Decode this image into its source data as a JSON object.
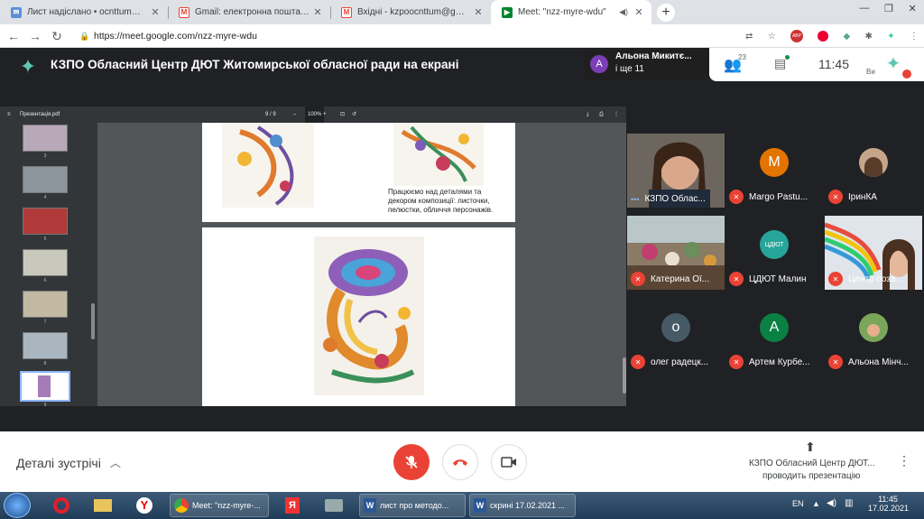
{
  "browser": {
    "tabs": [
      {
        "title": "Лист надіслано • ocnttum@ukr.",
        "icon": "mail-icon",
        "color": "#5b8fd6"
      },
      {
        "title": "Gmail: електронна пошта від Go",
        "icon": "gmail-icon",
        "color": "#ea4335"
      },
      {
        "title": "Вхідні - kzpoocnttum@gmail.com",
        "icon": "gmail-icon",
        "color": "#ea4335"
      },
      {
        "title": "Meet: \"nzz-myre-wdu\"",
        "icon": "meet-icon",
        "color": "#00832d"
      }
    ],
    "url": "https://meet.google.com/nzz-myre-wdu"
  },
  "meet": {
    "presenter_banner": "КЗПО Обласний Центр ДЮТ Житомирської обласної ради на екрані",
    "attendee_name": "Альона Микитє...",
    "attendee_more": "і ще 11",
    "attendee_initial": "А",
    "people_count": "23",
    "time": "11:45",
    "self_label": "Ви",
    "pdf_title": "Презентація.pdf",
    "pdf_page": "9 / 9",
    "pdf_zoom": "100%",
    "slide_caption": "Працюємо над деталями та декором композиції: листочки, пелюстки, обличчя персонажів.",
    "thumb_numbers": [
      "3",
      "4",
      "5",
      "6",
      "7",
      "8",
      "9"
    ],
    "participants": [
      {
        "name": "КЗПО Облас...",
        "type": "video",
        "muted": false
      },
      {
        "name": "Margo Pastu...",
        "initial": "M",
        "color": "#e37400",
        "type": "avatar",
        "muted": true
      },
      {
        "name": "ІринКА",
        "type": "photo",
        "muted": true
      },
      {
        "name": "Катерина Ої...",
        "type": "video",
        "muted": true
      },
      {
        "name": "ЦДЮТ Малин",
        "initial": "ЦДЮТ",
        "color": "#26a69a",
        "type": "avatar",
        "muted": true
      },
      {
        "name": "Центр поза...",
        "type": "video",
        "muted": true
      },
      {
        "name": "олег радецк...",
        "initial": "о",
        "color": "#455a64",
        "type": "avatar",
        "muted": true
      },
      {
        "name": "Артем Курбе...",
        "initial": "A",
        "color": "#0b8043",
        "type": "avatar",
        "muted": true
      },
      {
        "name": "Альона Мінч...",
        "type": "photo",
        "muted": true
      }
    ],
    "details_label": "Деталі зустрічі",
    "presenting_name": "КЗПО Обласний Центр ДЮТ...",
    "presenting_status": "проводить презентацію"
  },
  "taskbar": {
    "buttons": [
      "Meet: \"nzz-myre-...",
      "лист про методо...",
      "скрині 17.02.2021 ..."
    ],
    "lang": "EN",
    "time": "11:45",
    "date": "17.02.2021"
  }
}
